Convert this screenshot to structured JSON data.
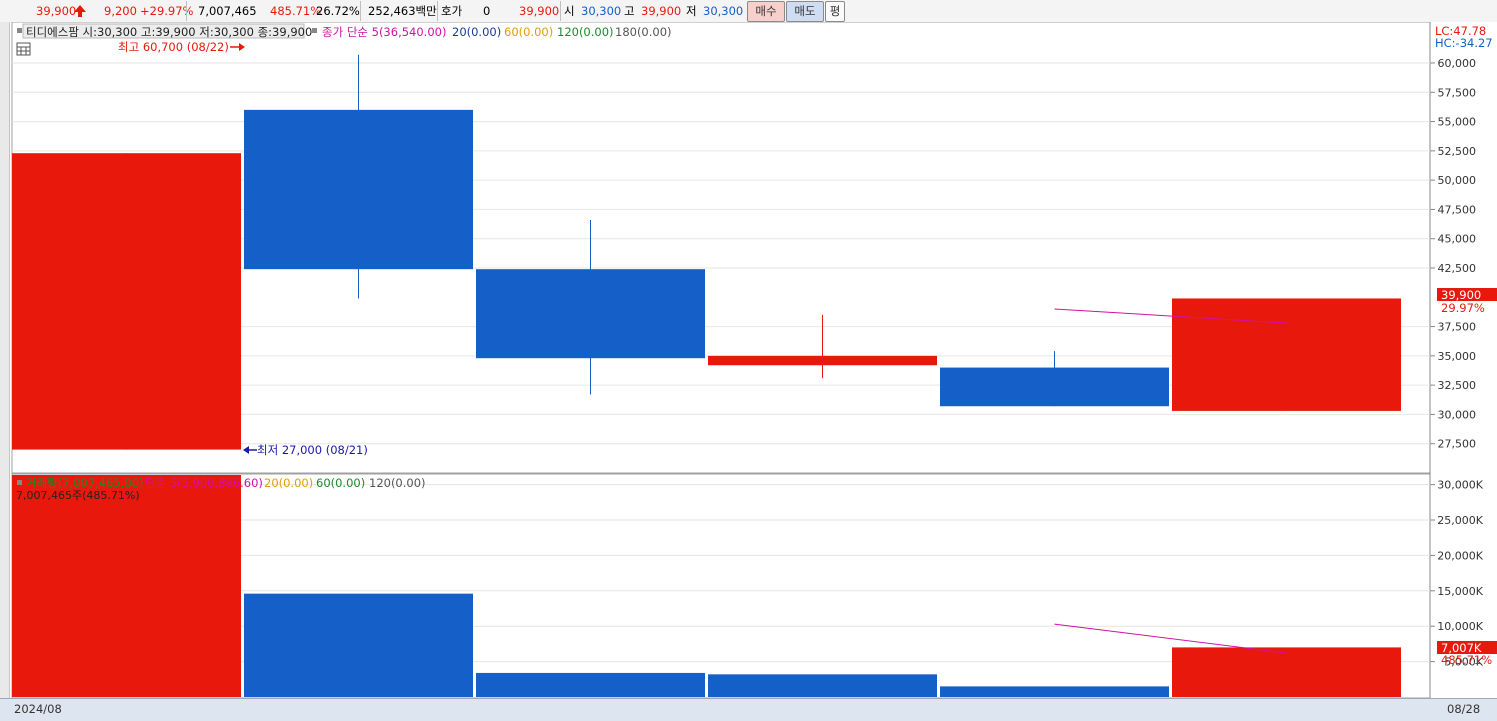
{
  "toolbar": {
    "price": "39,900",
    "change": "9,200",
    "change_pct": "+29.97%",
    "volume": "7,007,465",
    "volume_ratio": "485.71%",
    "turnover": "26.72%",
    "amount": "252,463백만",
    "quote_label": "호가",
    "quote_value": "0",
    "quote_price": "39,900",
    "open_label": "시",
    "open_value": "30,300",
    "high_label": "고",
    "high_value": "39,900",
    "low_label": "저",
    "low_value": "30,300",
    "buy_label": "매수",
    "sell_label": "매도",
    "avg_label": "평"
  },
  "colors": {
    "up": "#e8190c",
    "down": "#1560c8",
    "ma5": "#d010a8",
    "ma20": "#1a3a9a",
    "ma60": "#e0a000",
    "ma120": "#1a8a2a",
    "ma180": "#555555"
  },
  "price_panel": {
    "legend_stock": "티디에스팜 시:30,300 고:39,900 저:30,300 종:39,900",
    "legend_ma5": "종가 단순 5(36,540.00)",
    "legend_ma20": "20(0.00)",
    "legend_ma60": "60(0.00)",
    "legend_ma120": "120(0.00)",
    "legend_ma180": "180(0.00)",
    "high_marker": "최고 60,700 (08/22)",
    "low_marker": "최저 27,000 (08/21)",
    "lc": "LC:47.78",
    "hc": "HC:-34.27",
    "last_price": "39,900",
    "last_pct": "29.97%"
  },
  "volume_panel": {
    "legend_vol": "거래량(7,007,465.00)",
    "legend_ma5": "단순 5(5,900,886.60)",
    "legend_ma20": "20(0.00)",
    "legend_ma60": "60(0.00)",
    "legend_ma120": "120(0.00)",
    "vol_label": "7,007,465주(485.71%)",
    "last_vol": "7,007K",
    "last_pct": "485.71%"
  },
  "bottom": {
    "start_label": "2024/08",
    "end_label": "08/28"
  },
  "chart_data": [
    {
      "type": "candlestick",
      "y_ticks": [
        27500,
        30000,
        32500,
        35000,
        37500,
        42500,
        45000,
        47500,
        50000,
        52500,
        55000,
        57500,
        60000
      ],
      "y_tick_labels": [
        "27,500",
        "30,000",
        "32,500",
        "35,000",
        "37,500",
        "42,500",
        "45,000",
        "47,500",
        "50,000",
        "52,500",
        "55,000",
        "57,500",
        "60,000"
      ],
      "ylim": [
        25000,
        63500
      ],
      "candles": [
        {
          "open": 27000,
          "high": 52300,
          "low": 27000,
          "close": 52300
        },
        {
          "open": 56000,
          "high": 60700,
          "low": 39900,
          "close": 42400
        },
        {
          "open": 42400,
          "high": 46600,
          "low": 31700,
          "close": 34800
        },
        {
          "open": 34200,
          "high": 38500,
          "low": 33100,
          "close": 35000
        },
        {
          "open": 34000,
          "high": 35400,
          "low": 30700,
          "close": 30700
        },
        {
          "open": 30300,
          "high": 39900,
          "low": 30300,
          "close": 39900
        }
      ],
      "ma5": [
        null,
        null,
        null,
        null,
        39000,
        37800
      ]
    },
    {
      "type": "bar",
      "y_ticks": [
        5000,
        10000,
        15000,
        20000,
        25000,
        30000
      ],
      "y_tick_labels": [
        "5,000K",
        "10,000K",
        "15,000K",
        "20,000K",
        "25,000K",
        "30,000K"
      ],
      "ylim": [
        0,
        31500
      ],
      "values": [
        31500,
        14600,
        3400,
        3200,
        1500,
        7007
      ],
      "directions": [
        "up",
        "down",
        "down",
        "down",
        "down",
        "up"
      ],
      "ma5": [
        null,
        null,
        null,
        null,
        10300,
        6200
      ]
    }
  ]
}
